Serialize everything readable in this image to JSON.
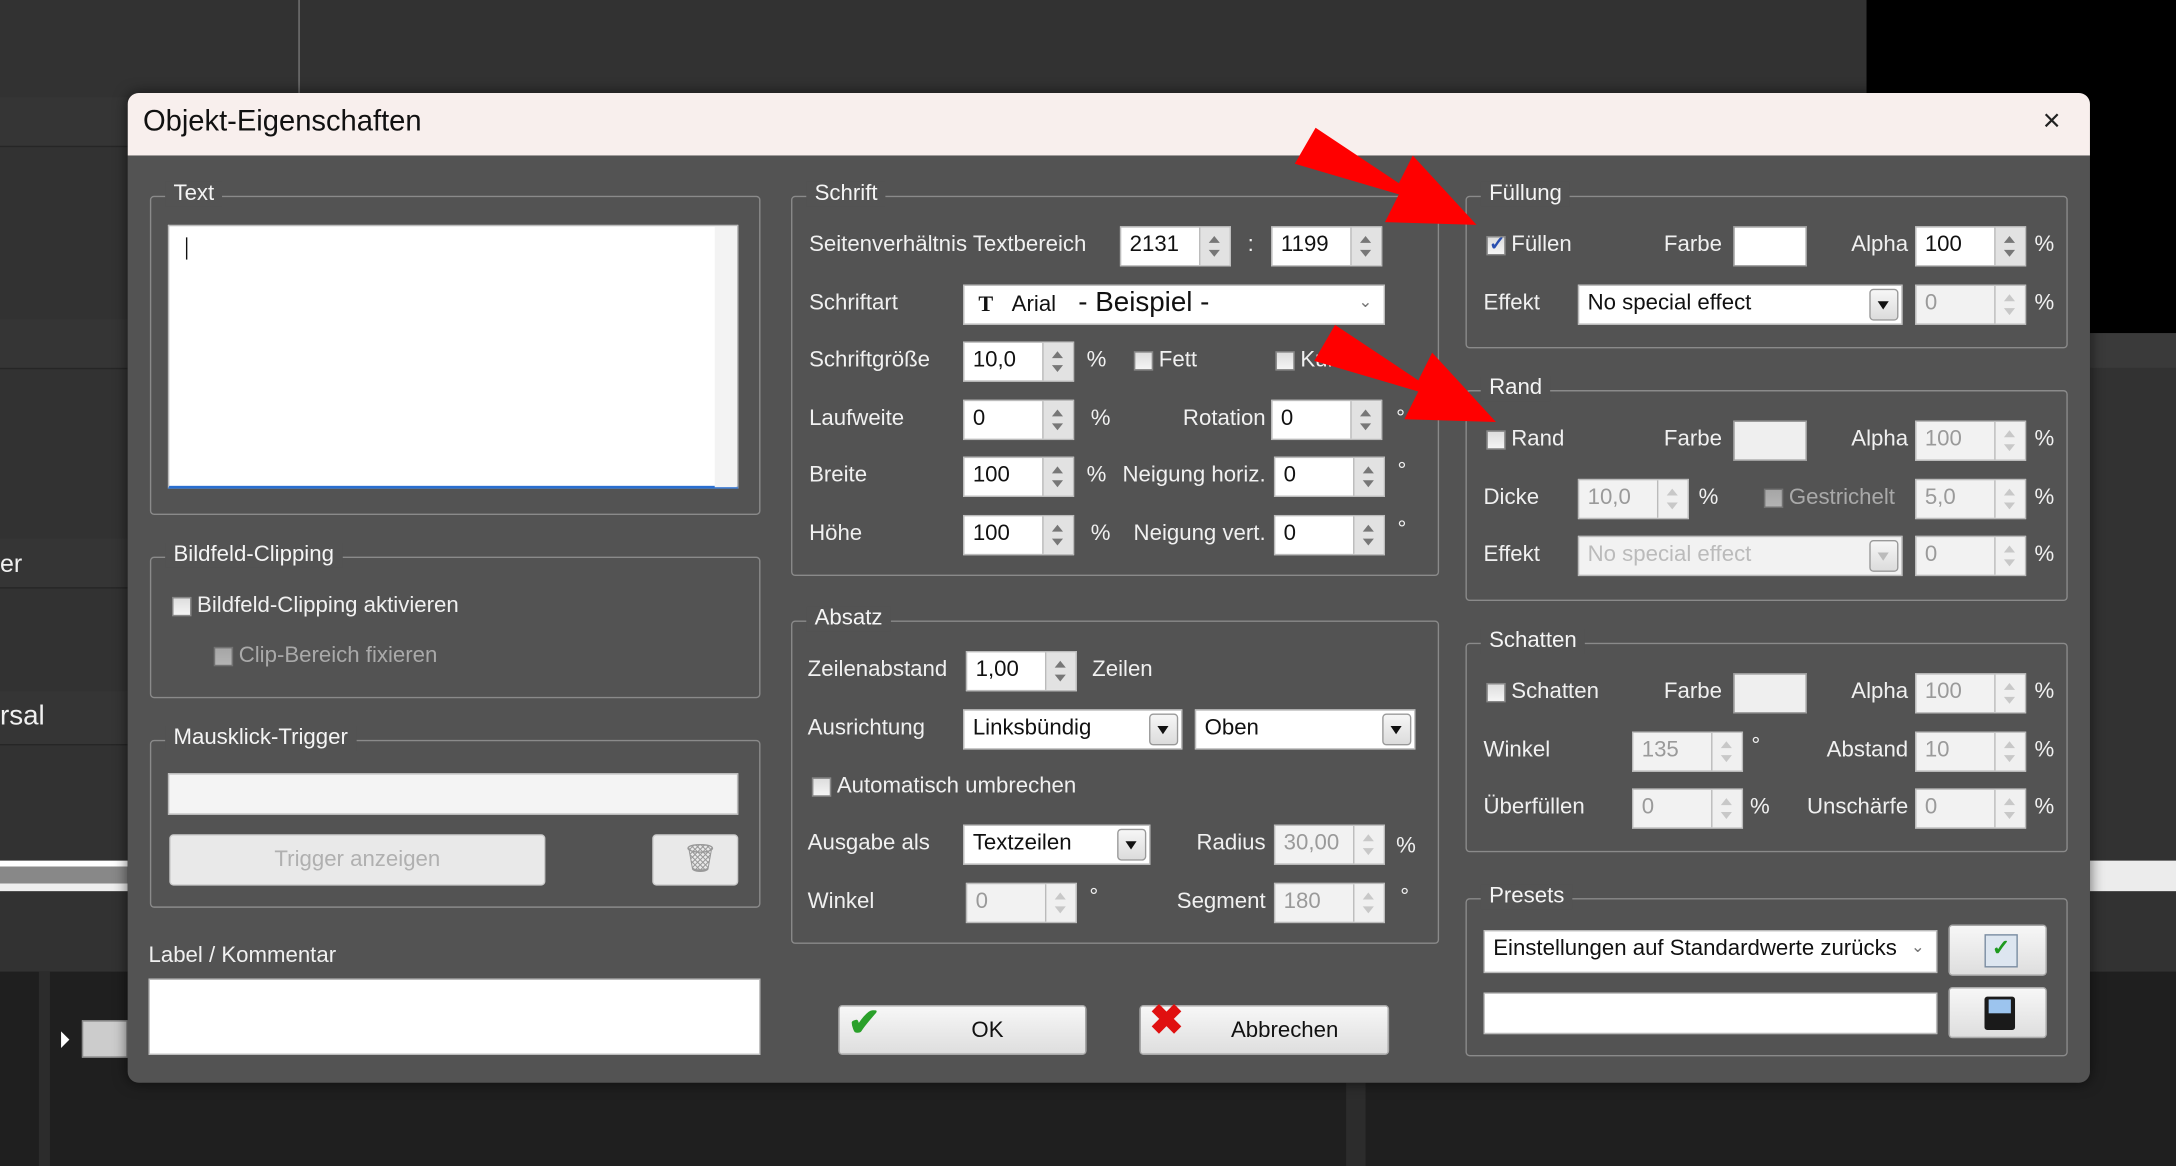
{
  "background": {
    "fragment_1": "er",
    "fragment_2": "rsal"
  },
  "dialog": {
    "title": "Objekt-Eigenschaften"
  },
  "text_group": {
    "legend": "Text",
    "value": ""
  },
  "clipping": {
    "legend": "Bildfeld-Clipping",
    "enable_label": "Bildfeld-Clipping aktivieren",
    "enable_checked": false,
    "fix_label": "Clip-Bereich fixieren",
    "fix_checked": false
  },
  "trigger": {
    "legend": "Mausklick-Trigger",
    "value": "",
    "show_button": "Trigger anzeigen"
  },
  "label_comment": {
    "label": "Label / Kommentar",
    "value": ""
  },
  "schrift": {
    "legend": "Schrift",
    "aspect_label": "Seitenverhältnis Textbereich",
    "aspect_w": "2131",
    "aspect_sep": ":",
    "aspect_h": "1199",
    "font_label": "Schriftart",
    "font_name": "Arial",
    "font_sample": "- Beispiel -",
    "size_label": "Schriftgröße",
    "size_value": "10,0",
    "size_unit": "%",
    "bold_label": "Fett",
    "bold_checked": false,
    "italic_label": "Kursiv",
    "italic_checked": false,
    "tracking_label": "Laufweite",
    "tracking_value": "0",
    "tracking_unit": "%",
    "rotation_label": "Rotation",
    "rotation_value": "0",
    "rotation_unit": "°",
    "width_label": "Breite",
    "width_value": "100",
    "width_unit": "%",
    "skew_h_label": "Neigung horiz.",
    "skew_h_value": "0",
    "skew_h_unit": "°",
    "height_label": "Höhe",
    "height_value": "100",
    "height_unit": "%",
    "skew_v_label": "Neigung vert.",
    "skew_v_value": "0",
    "skew_v_unit": "°"
  },
  "absatz": {
    "legend": "Absatz",
    "line_spacing_label": "Zeilenabstand",
    "line_spacing_value": "1,00",
    "line_spacing_unit": "Zeilen",
    "align_label": "Ausrichtung",
    "align_h": "Linksbündig",
    "align_v": "Oben",
    "wrap_label": "Automatisch umbrechen",
    "wrap_checked": false,
    "output_label": "Ausgabe als",
    "output_value": "Textzeilen",
    "radius_label": "Radius",
    "radius_value": "30,00",
    "radius_unit": "%",
    "angle_label": "Winkel",
    "angle_value": "0",
    "angle_unit": "°",
    "segment_label": "Segment",
    "segment_value": "180",
    "segment_unit": "°"
  },
  "buttons": {
    "ok": "OK",
    "cancel": "Abbrechen"
  },
  "fuellung": {
    "legend": "Füllung",
    "fill_label": "Füllen",
    "fill_checked": true,
    "color_label": "Farbe",
    "color": "#ffffff",
    "alpha_label": "Alpha",
    "alpha_value": "100",
    "alpha_unit": "%",
    "effect_label": "Effekt",
    "effect_value": "No special effect",
    "effect_amount": "0",
    "effect_unit": "%"
  },
  "rand": {
    "legend": "Rand",
    "border_label": "Rand",
    "border_checked": false,
    "color_label": "Farbe",
    "alpha_label": "Alpha",
    "alpha_value": "100",
    "alpha_unit": "%",
    "thickness_label": "Dicke",
    "thickness_value": "10,0",
    "thickness_unit": "%",
    "dashed_label": "Gestrichelt",
    "dashed_checked": false,
    "dash_value": "5,0",
    "dash_unit": "%",
    "effect_label": "Effekt",
    "effect_value": "No special effect",
    "effect_amount": "0",
    "effect_unit": "%"
  },
  "schatten": {
    "legend": "Schatten",
    "shadow_label": "Schatten",
    "shadow_checked": false,
    "color_label": "Farbe",
    "alpha_label": "Alpha",
    "alpha_value": "100",
    "alpha_unit": "%",
    "angle_label": "Winkel",
    "angle_value": "135",
    "angle_unit": "°",
    "distance_label": "Abstand",
    "distance_value": "10",
    "distance_unit": "%",
    "spread_label": "Überfüllen",
    "spread_value": "0",
    "spread_unit": "%",
    "blur_label": "Unschärfe",
    "blur_value": "0",
    "blur_unit": "%"
  },
  "presets": {
    "legend": "Presets",
    "selected": "Einstellungen auf Standardwerte zurücks",
    "name_value": ""
  },
  "colors": {
    "dialog_bg": "#535353",
    "titlebar": "#f8efed",
    "annotation_arrow": "#ff0000"
  },
  "icons": {
    "close": "close-icon",
    "apply_preset": "checklist-icon",
    "save_preset": "floppy-disk-icon",
    "delete_trigger": "trash-icon",
    "font": "font-icon",
    "ok": "green-check-icon",
    "cancel": "red-x-icon"
  }
}
